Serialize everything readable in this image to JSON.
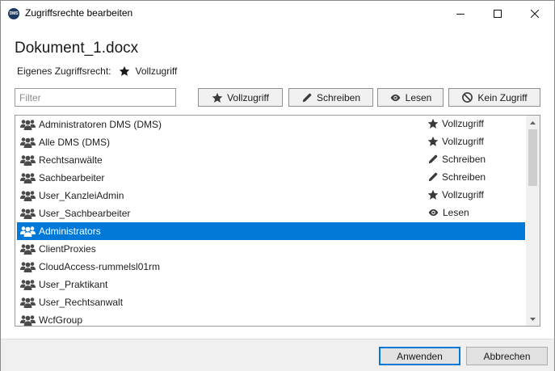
{
  "window": {
    "title": "Zugriffsrechte bearbeiten",
    "app_icon_text": "DMS",
    "controls": [
      "minimize",
      "maximize",
      "close"
    ]
  },
  "document": {
    "name": "Dokument_1.docx",
    "own_rights_label": "Eigenes Zugriffsrecht:",
    "own_rights_value": "Vollzugriff",
    "own_rights_icon": "star-icon"
  },
  "filter": {
    "placeholder": "Filter",
    "value": ""
  },
  "permission_buttons": [
    {
      "label": "Vollzugriff",
      "icon": "star-icon"
    },
    {
      "label": "Schreiben",
      "icon": "pencil-icon"
    },
    {
      "label": "Lesen",
      "icon": "eye-icon"
    },
    {
      "label": "Kein Zugriff",
      "icon": "no-access-icon"
    }
  ],
  "groups": [
    {
      "name": "Administratoren DMS (DMS)",
      "permission": "Vollzugriff",
      "permission_icon": "star-icon",
      "selected": false
    },
    {
      "name": "Alle DMS (DMS)",
      "permission": "Vollzugriff",
      "permission_icon": "star-icon",
      "selected": false
    },
    {
      "name": "Rechtsanwälte",
      "permission": "Schreiben",
      "permission_icon": "pencil-icon",
      "selected": false
    },
    {
      "name": "Sachbearbeiter",
      "permission": "Schreiben",
      "permission_icon": "pencil-icon",
      "selected": false
    },
    {
      "name": "User_KanzleiAdmin",
      "permission": "Vollzugriff",
      "permission_icon": "star-icon",
      "selected": false
    },
    {
      "name": "User_Sachbearbeiter",
      "permission": "Lesen",
      "permission_icon": "eye-icon",
      "selected": false
    },
    {
      "name": "Administrators",
      "permission": "",
      "permission_icon": "",
      "selected": true
    },
    {
      "name": "ClientProxies",
      "permission": "",
      "permission_icon": "",
      "selected": false
    },
    {
      "name": "CloudAccess-rummelsl01rm",
      "permission": "",
      "permission_icon": "",
      "selected": false
    },
    {
      "name": "User_Praktikant",
      "permission": "",
      "permission_icon": "",
      "selected": false
    },
    {
      "name": "User_Rechtsanwalt",
      "permission": "",
      "permission_icon": "",
      "selected": false
    },
    {
      "name": "WcfGroup",
      "permission": "",
      "permission_icon": "",
      "selected": false
    }
  ],
  "footer": {
    "apply_label": "Anwenden",
    "cancel_label": "Abbrechen"
  },
  "colors": {
    "selection": "#0078d7",
    "icon": "#3a3a3a",
    "default_button_border": "#0078d7"
  }
}
